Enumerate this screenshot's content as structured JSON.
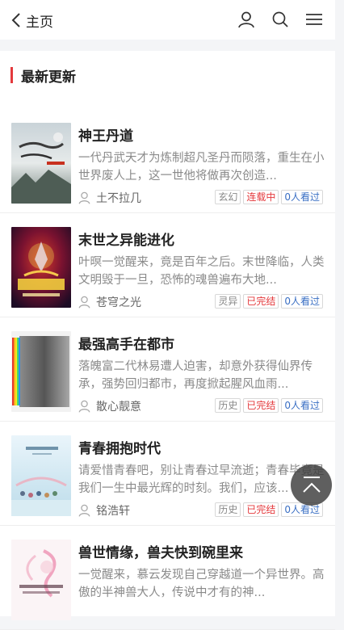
{
  "header": {
    "back_label": "主页",
    "icons": [
      "user-icon",
      "search-icon",
      "menu-icon"
    ]
  },
  "section": {
    "title": "最新更新"
  },
  "books": [
    {
      "title": "神王丹道",
      "desc": "一代丹武天才为炼制超凡圣丹而陨落，重生在小世界废人上，这一世他将做再次创造...",
      "author": "土不拉几",
      "genre": "玄幻",
      "status": "连载中",
      "views": "0人看过"
    },
    {
      "title": "末世之异能进化",
      "desc": "叶暝一觉醒来，竟是百年之后。末世降临，人类文明毁于一旦，恐怖的魂兽遍布大地...",
      "author": "苍穹之光",
      "genre": "灵异",
      "status": "已完结",
      "views": "0人看过"
    },
    {
      "title": "最强高手在都市",
      "desc": "落魄富二代林易遭人迫害，却意外获得仙界传承，强势回归都市，再度掀起腥风血雨...",
      "author": "散心靓意",
      "genre": "历史",
      "status": "已完结",
      "views": "0人看过"
    },
    {
      "title": "青春拥抱时代",
      "desc": "请爱惜青春吧，别让青春过早流逝；青春毕竟是我们一生中最光辉的时刻。我们，应该...",
      "author": "铭浩轩",
      "genre": "历史",
      "status": "已完结",
      "views": "0人看过"
    },
    {
      "title": "兽世情缘，兽夫快到碗里来",
      "desc": "一觉醒来，慕云发现自己穿越道一个异世界。高傲的半神兽大人，传说中才有的神...",
      "author": "",
      "genre": "",
      "status": "",
      "views": ""
    }
  ],
  "colors": {
    "accent": "#e4393c",
    "blue": "#3a6fc4"
  }
}
